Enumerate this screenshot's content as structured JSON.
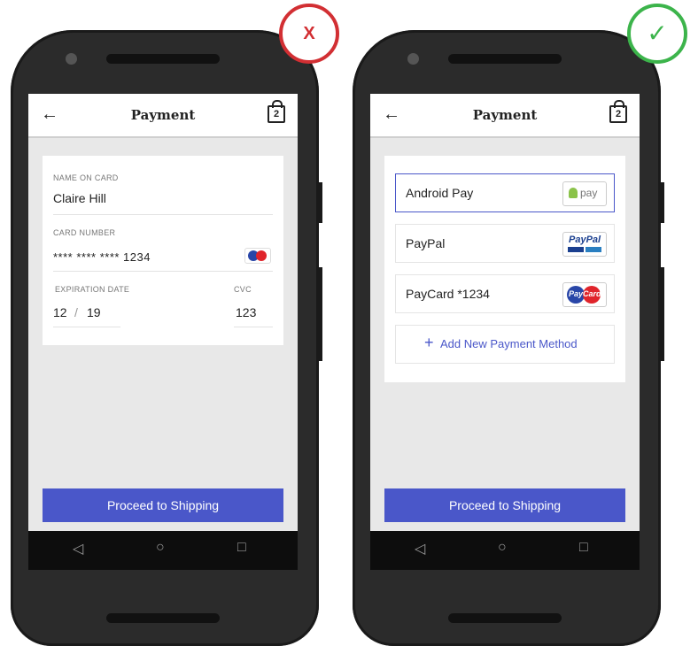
{
  "bad_screen": {
    "title": "Payment",
    "cart_count": "2",
    "name_label": "NAME ON CARD",
    "name_value": "Claire Hill",
    "card_number_label": "CARD NUMBER",
    "card_number_value": "**** **** **** 1234",
    "exp_label": "EXPIRATION DATE",
    "exp_month": "12",
    "exp_sep": "/",
    "exp_year": "19",
    "cvc_label": "CVC",
    "cvc_value": "123",
    "proceed": "Proceed to Shipping",
    "marker": "X"
  },
  "good_screen": {
    "title": "Payment",
    "cart_count": "2",
    "methods": [
      {
        "label": "Android Pay",
        "badge": "pay"
      },
      {
        "label": "PayPal",
        "badge": "PayPal"
      },
      {
        "label": "PayCard *1234",
        "badge": "PayCard"
      }
    ],
    "add_method": "Add New Payment Method",
    "proceed": "Proceed to Shipping",
    "marker": "✓"
  },
  "nav": {
    "back": "◁",
    "home": "○",
    "recents": "□"
  },
  "colors": {
    "accent": "#4a57c9",
    "bad": "#d22f33",
    "good": "#3cb44b"
  }
}
